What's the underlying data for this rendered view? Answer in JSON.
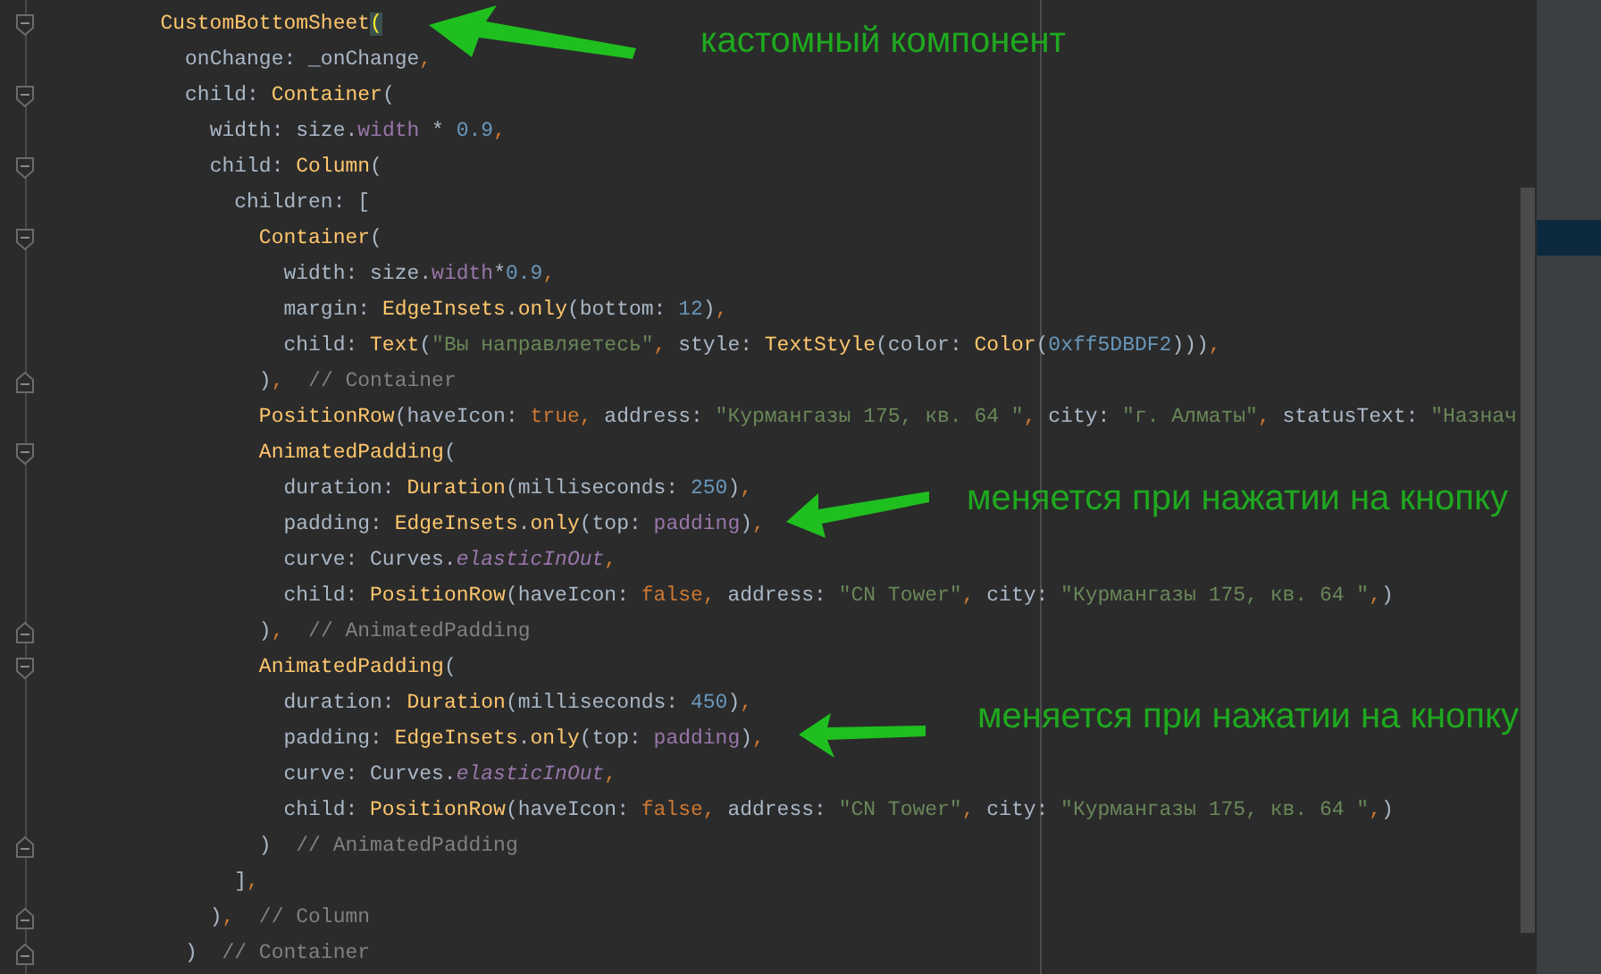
{
  "editor": {
    "lines": [
      {
        "kind": "fold_start",
        "tokens": [
          {
            "kind": "class",
            "text": "CustomBottomSheet"
          },
          {
            "kind": "match",
            "text": "("
          }
        ],
        "children": [
          {
            "tokens": [
              {
                "kind": "plain",
                "text": "onChange: _onChange"
              },
              {
                "kind": "keyword",
                "text": ","
              }
            ]
          },
          {
            "kind": "fold_start",
            "tokens": [
              {
                "kind": "plain",
                "text": "child: "
              },
              {
                "kind": "class",
                "text": "Container"
              },
              {
                "kind": "plain",
                "text": "("
              }
            ],
            "children": [
              {
                "tokens": [
                  {
                    "kind": "plain",
                    "text": "width: size."
                  },
                  {
                    "kind": "field",
                    "text": "width"
                  },
                  {
                    "kind": "plain",
                    "text": " * "
                  },
                  {
                    "kind": "number",
                    "text": "0.9"
                  },
                  {
                    "kind": "keyword",
                    "text": ","
                  }
                ]
              },
              {
                "kind": "fold_start",
                "tokens": [
                  {
                    "kind": "plain",
                    "text": "child: "
                  },
                  {
                    "kind": "class",
                    "text": "Column"
                  },
                  {
                    "kind": "plain",
                    "text": "("
                  }
                ],
                "children": [
                  {
                    "tokens": [
                      {
                        "kind": "plain",
                        "text": "children: ["
                      }
                    ],
                    "children": [
                      {
                        "kind": "fold_start",
                        "tokens": [
                          {
                            "kind": "class",
                            "text": "Container"
                          },
                          {
                            "kind": "plain",
                            "text": "("
                          }
                        ],
                        "children": [
                          {
                            "tokens": [
                              {
                                "kind": "plain",
                                "text": "width: size."
                              },
                              {
                                "kind": "field",
                                "text": "width"
                              },
                              {
                                "kind": "plain",
                                "text": "*"
                              },
                              {
                                "kind": "number",
                                "text": "0.9"
                              },
                              {
                                "kind": "keyword",
                                "text": ","
                              }
                            ]
                          },
                          {
                            "tokens": [
                              {
                                "kind": "plain",
                                "text": "margin: "
                              },
                              {
                                "kind": "class",
                                "text": "EdgeInsets"
                              },
                              {
                                "kind": "plain",
                                "text": "."
                              },
                              {
                                "kind": "class",
                                "text": "only"
                              },
                              {
                                "kind": "plain",
                                "text": "(bottom: "
                              },
                              {
                                "kind": "number",
                                "text": "12"
                              },
                              {
                                "kind": "plain",
                                "text": ")"
                              },
                              {
                                "kind": "keyword",
                                "text": ","
                              }
                            ]
                          },
                          {
                            "tokens": [
                              {
                                "kind": "plain",
                                "text": "child: "
                              },
                              {
                                "kind": "class",
                                "text": "Text"
                              },
                              {
                                "kind": "plain",
                                "text": "("
                              },
                              {
                                "kind": "string",
                                "text": "\"Вы направляетесь\""
                              },
                              {
                                "kind": "keyword",
                                "text": ","
                              },
                              {
                                "kind": "plain",
                                "text": " style: "
                              },
                              {
                                "kind": "class",
                                "text": "TextStyle"
                              },
                              {
                                "kind": "plain",
                                "text": "(color: "
                              },
                              {
                                "kind": "class",
                                "text": "Color"
                              },
                              {
                                "kind": "plain",
                                "text": "("
                              },
                              {
                                "kind": "number",
                                "text": "0xff5DBDF2"
                              },
                              {
                                "kind": "plain",
                                "text": ")))"
                              },
                              {
                                "kind": "keyword",
                                "text": ","
                              }
                            ]
                          }
                        ]
                      },
                      {
                        "kind": "fold_end",
                        "tokens": [
                          {
                            "kind": "plain",
                            "text": ")"
                          },
                          {
                            "kind": "keyword",
                            "text": ","
                          },
                          {
                            "kind": "comment",
                            "text": "  // Container"
                          }
                        ]
                      },
                      {
                        "tokens": [
                          {
                            "kind": "class",
                            "text": "PositionRow"
                          },
                          {
                            "kind": "plain",
                            "text": "(haveIcon: "
                          },
                          {
                            "kind": "keyword",
                            "text": "true"
                          },
                          {
                            "kind": "keyword",
                            "text": ","
                          },
                          {
                            "kind": "plain",
                            "text": " address: "
                          },
                          {
                            "kind": "string",
                            "text": "\"Курмангазы 175, кв. 64 \""
                          },
                          {
                            "kind": "keyword",
                            "text": ","
                          },
                          {
                            "kind": "plain",
                            "text": " city: "
                          },
                          {
                            "kind": "string",
                            "text": "\"г. Алматы\""
                          },
                          {
                            "kind": "keyword",
                            "text": ","
                          },
                          {
                            "kind": "plain",
                            "text": " statusText: "
                          },
                          {
                            "kind": "string",
                            "text": "\"Назнач"
                          }
                        ]
                      },
                      {
                        "kind": "fold_start",
                        "tokens": [
                          {
                            "kind": "class",
                            "text": "AnimatedPadding"
                          },
                          {
                            "kind": "plain",
                            "text": "("
                          }
                        ],
                        "children": [
                          {
                            "tokens": [
                              {
                                "kind": "plain",
                                "text": "duration: "
                              },
                              {
                                "kind": "class",
                                "text": "Duration"
                              },
                              {
                                "kind": "plain",
                                "text": "(milliseconds: "
                              },
                              {
                                "kind": "number",
                                "text": "250"
                              },
                              {
                                "kind": "plain",
                                "text": ")"
                              },
                              {
                                "kind": "keyword",
                                "text": ","
                              }
                            ]
                          },
                          {
                            "tokens": [
                              {
                                "kind": "plain",
                                "text": "padding: "
                              },
                              {
                                "kind": "class",
                                "text": "EdgeInsets"
                              },
                              {
                                "kind": "plain",
                                "text": "."
                              },
                              {
                                "kind": "class",
                                "text": "only"
                              },
                              {
                                "kind": "plain",
                                "text": "(top: "
                              },
                              {
                                "kind": "field",
                                "text": "padding"
                              },
                              {
                                "kind": "plain",
                                "text": ")"
                              },
                              {
                                "kind": "keyword",
                                "text": ","
                              }
                            ]
                          },
                          {
                            "tokens": [
                              {
                                "kind": "plain",
                                "text": "curve: Curves."
                              },
                              {
                                "kind": "static",
                                "text": "elasticInOut"
                              },
                              {
                                "kind": "keyword",
                                "text": ","
                              }
                            ]
                          },
                          {
                            "tokens": [
                              {
                                "kind": "plain",
                                "text": "child: "
                              },
                              {
                                "kind": "class",
                                "text": "PositionRow"
                              },
                              {
                                "kind": "plain",
                                "text": "(haveIcon: "
                              },
                              {
                                "kind": "keyword",
                                "text": "false"
                              },
                              {
                                "kind": "keyword",
                                "text": ","
                              },
                              {
                                "kind": "plain",
                                "text": " address: "
                              },
                              {
                                "kind": "string",
                                "text": "\"CN Tower\""
                              },
                              {
                                "kind": "keyword",
                                "text": ","
                              },
                              {
                                "kind": "plain",
                                "text": " city: "
                              },
                              {
                                "kind": "string",
                                "text": "\"Курмангазы 175, кв. 64 \""
                              },
                              {
                                "kind": "keyword",
                                "text": ","
                              },
                              {
                                "kind": "plain",
                                "text": ")"
                              }
                            ]
                          }
                        ]
                      },
                      {
                        "kind": "fold_end",
                        "tokens": [
                          {
                            "kind": "plain",
                            "text": ")"
                          },
                          {
                            "kind": "keyword",
                            "text": ","
                          },
                          {
                            "kind": "comment",
                            "text": "  // AnimatedPadding"
                          }
                        ]
                      },
                      {
                        "kind": "fold_start",
                        "tokens": [
                          {
                            "kind": "class",
                            "text": "AnimatedPadding"
                          },
                          {
                            "kind": "plain",
                            "text": "("
                          }
                        ],
                        "children": [
                          {
                            "tokens": [
                              {
                                "kind": "plain",
                                "text": "duration: "
                              },
                              {
                                "kind": "class",
                                "text": "Duration"
                              },
                              {
                                "kind": "plain",
                                "text": "(milliseconds: "
                              },
                              {
                                "kind": "number",
                                "text": "450"
                              },
                              {
                                "kind": "plain",
                                "text": ")"
                              },
                              {
                                "kind": "keyword",
                                "text": ","
                              }
                            ]
                          },
                          {
                            "tokens": [
                              {
                                "kind": "plain",
                                "text": "padding: "
                              },
                              {
                                "kind": "class",
                                "text": "EdgeInsets"
                              },
                              {
                                "kind": "plain",
                                "text": "."
                              },
                              {
                                "kind": "class",
                                "text": "only"
                              },
                              {
                                "kind": "plain",
                                "text": "(top: "
                              },
                              {
                                "kind": "field",
                                "text": "padding"
                              },
                              {
                                "kind": "plain",
                                "text": ")"
                              },
                              {
                                "kind": "keyword",
                                "text": ","
                              }
                            ]
                          },
                          {
                            "tokens": [
                              {
                                "kind": "plain",
                                "text": "curve: Curves."
                              },
                              {
                                "kind": "static",
                                "text": "elasticInOut"
                              },
                              {
                                "kind": "keyword",
                                "text": ","
                              }
                            ]
                          },
                          {
                            "tokens": [
                              {
                                "kind": "plain",
                                "text": "child: "
                              },
                              {
                                "kind": "class",
                                "text": "PositionRow"
                              },
                              {
                                "kind": "plain",
                                "text": "(haveIcon: "
                              },
                              {
                                "kind": "keyword",
                                "text": "false"
                              },
                              {
                                "kind": "keyword",
                                "text": ","
                              },
                              {
                                "kind": "plain",
                                "text": " address: "
                              },
                              {
                                "kind": "string",
                                "text": "\"CN Tower\""
                              },
                              {
                                "kind": "keyword",
                                "text": ","
                              },
                              {
                                "kind": "plain",
                                "text": " city: "
                              },
                              {
                                "kind": "string",
                                "text": "\"Курмангазы 175, кв. 64 \""
                              },
                              {
                                "kind": "keyword",
                                "text": ","
                              },
                              {
                                "kind": "plain",
                                "text": ")"
                              }
                            ]
                          }
                        ]
                      },
                      {
                        "kind": "fold_end",
                        "tokens": [
                          {
                            "kind": "plain",
                            "text": ")"
                          },
                          {
                            "kind": "comment",
                            "text": "  // AnimatedPadding"
                          }
                        ]
                      }
                    ]
                  },
                  {
                    "tokens": [
                      {
                        "kind": "plain",
                        "text": "]"
                      },
                      {
                        "kind": "keyword",
                        "text": ","
                      }
                    ]
                  }
                ]
              },
              {
                "kind": "fold_end",
                "tokens": [
                  {
                    "kind": "plain",
                    "text": ")"
                  },
                  {
                    "kind": "keyword",
                    "text": ","
                  },
                  {
                    "kind": "comment",
                    "text": "  // Column"
                  }
                ]
              }
            ]
          },
          {
            "kind": "fold_end",
            "tokens": [
              {
                "kind": "plain",
                "text": ")"
              },
              {
                "kind": "comment",
                "text": "  // Container"
              }
            ]
          }
        ]
      }
    ]
  },
  "annotations": [
    {
      "text": "кастомный компонент"
    },
    {
      "text": "меняется при нажатии на кнопку"
    },
    {
      "text": "меняется при нажатии на кнопку"
    }
  ]
}
